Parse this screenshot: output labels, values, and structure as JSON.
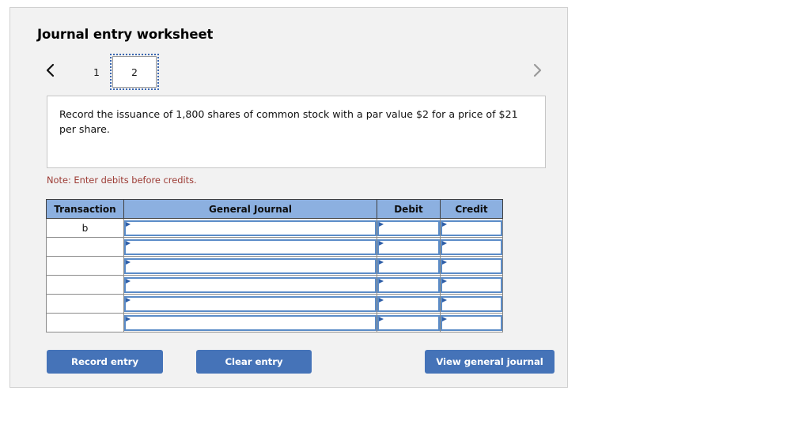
{
  "panel": {
    "title": "Journal entry worksheet"
  },
  "pager": {
    "prev_icon": "chevron-left-icon",
    "next_icon": "chevron-right-icon",
    "prev_enabled": true,
    "next_enabled": false,
    "tabs": [
      {
        "label": "1",
        "active": false
      },
      {
        "label": "2",
        "active": true
      }
    ]
  },
  "instruction": {
    "text": "Record the issuance of 1,800 shares of common stock with a par value $2 for a price of $21 per share."
  },
  "note": {
    "text": "Note: Enter debits before credits."
  },
  "table": {
    "headers": [
      "Transaction",
      "General Journal",
      "Debit",
      "Credit"
    ],
    "rows": [
      {
        "transaction": "b",
        "general_journal": "",
        "debit": "",
        "credit": ""
      },
      {
        "transaction": "",
        "general_journal": "",
        "debit": "",
        "credit": ""
      },
      {
        "transaction": "",
        "general_journal": "",
        "debit": "",
        "credit": ""
      },
      {
        "transaction": "",
        "general_journal": "",
        "debit": "",
        "credit": ""
      },
      {
        "transaction": "",
        "general_journal": "",
        "debit": "",
        "credit": ""
      },
      {
        "transaction": "",
        "general_journal": "",
        "debit": "",
        "credit": ""
      }
    ]
  },
  "buttons": {
    "record_entry": "Record entry",
    "clear_entry": "Clear entry",
    "view_general_journal": "View general journal"
  },
  "colors": {
    "panel_background": "#f2f2f2",
    "table_header": "#8cb0e0",
    "button": "#4573b8",
    "note": "#9c3a33",
    "input_border": "#5b8cc8",
    "tab_focus_outline": "#3a66b0"
  }
}
